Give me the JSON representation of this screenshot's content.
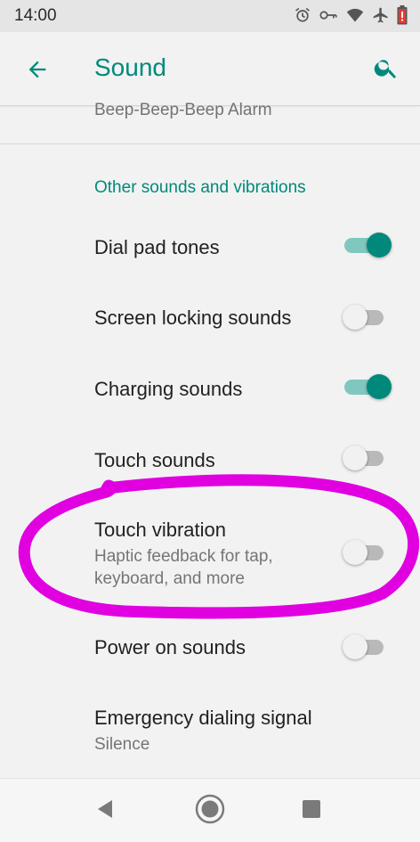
{
  "status_bar": {
    "time": "14:00",
    "icons": [
      "alarm-icon",
      "vpn-key-icon",
      "wifi-icon",
      "airplane-icon",
      "battery-low-icon"
    ]
  },
  "app_bar": {
    "title": "Sound",
    "back_icon": "arrow-back-icon",
    "search_icon": "search-icon"
  },
  "previous_setting_summary": "Beep-Beep-Beep Alarm",
  "section": {
    "header": "Other sounds and vibrations",
    "items": [
      {
        "title": "Dial pad tones",
        "subtitle": "",
        "enabled": true
      },
      {
        "title": "Screen locking sounds",
        "subtitle": "",
        "enabled": false
      },
      {
        "title": "Charging sounds",
        "subtitle": "",
        "enabled": true
      },
      {
        "title": "Touch sounds",
        "subtitle": "",
        "enabled": false
      },
      {
        "title": "Touch vibration",
        "subtitle_line1": "Haptic feedback for tap,",
        "subtitle_line2": "keyboard, and more",
        "enabled": false
      },
      {
        "title": "Power on sounds",
        "subtitle": "",
        "enabled": false
      },
      {
        "title": "Emergency dialing signal",
        "subtitle": "Silence"
      }
    ]
  },
  "nav_bar": {
    "icons": [
      "back-triangle-icon",
      "home-circle-icon",
      "recents-square-icon"
    ]
  },
  "colors": {
    "accent": "#00897b",
    "switch_on_track": "#80c8bf",
    "switch_off_track": "#b9b9b9",
    "annotation": "#e000e0"
  }
}
